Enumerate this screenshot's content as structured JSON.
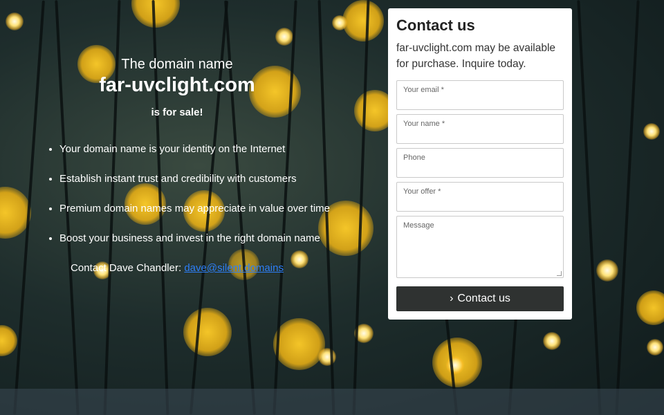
{
  "promo": {
    "line1": "The domain name",
    "domain": "far-uvclight.com",
    "line3": "is for sale!",
    "bullets": [
      "Your domain name is your identity on the Internet",
      "Establish instant trust and credibility with customers",
      "Premium domain names may appreciate in value over time",
      "Boost your business and invest in the right domain name"
    ],
    "contact_prefix": "Contact Dave Chandler: ",
    "contact_email": "dave@silent.domains"
  },
  "form": {
    "title": "Contact us",
    "description": "far-uvclight.com may be available for purchase. Inquire today.",
    "email_placeholder": "Your email *",
    "name_placeholder": "Your name *",
    "phone_placeholder": "Phone",
    "offer_placeholder": "Your offer *",
    "message_placeholder": "Message",
    "submit_label": "Contact us",
    "submit_icon": "chevron-right-icon"
  },
  "colors": {
    "link": "#2d7ff9",
    "button_bg": "#2f3231",
    "bokeh": "#f5c518"
  }
}
